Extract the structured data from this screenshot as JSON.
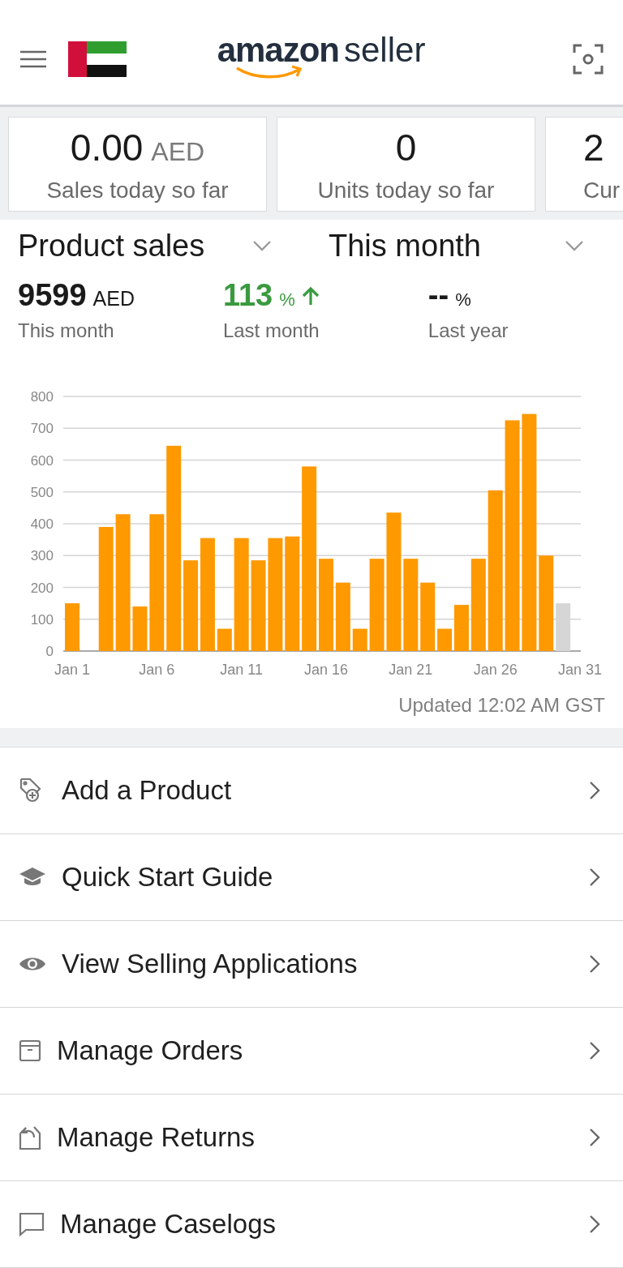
{
  "header": {
    "logo_word": "amazon",
    "logo_suffix": "seller"
  },
  "stat_cards": [
    {
      "value": "0.00",
      "unit": "AED",
      "label": "Sales today so far",
      "kind": "full"
    },
    {
      "value": "0",
      "label": "Units today so far",
      "kind": "full"
    },
    {
      "value": "2",
      "label": "Cur",
      "kind": "partial"
    }
  ],
  "selectors": [
    {
      "label": "Product sales"
    },
    {
      "label": "This month"
    }
  ],
  "metrics": [
    {
      "value": "9599",
      "unit": "AED",
      "label": "This month",
      "kind": "plain"
    },
    {
      "value": "113",
      "unit": "%",
      "label": "Last month",
      "kind": "rising"
    },
    {
      "value": "--",
      "unit": "%",
      "label": "Last year",
      "kind": "plain"
    }
  ],
  "chart": {
    "chart_data": {
      "type": "bar",
      "stacked": true,
      "grid": true,
      "categories": [
        "Jan 1",
        null,
        null,
        null,
        null,
        "Jan 6",
        null,
        null,
        null,
        null,
        "Jan 11",
        null,
        null,
        null,
        null,
        "Jan 16",
        null,
        null,
        null,
        null,
        "Jan 21",
        null,
        null,
        null,
        null,
        "Jan 26",
        null,
        null,
        null,
        null,
        "Jan 31"
      ],
      "yticks": [
        0,
        100,
        200,
        300,
        400,
        500,
        600,
        700,
        800
      ],
      "ylim": [
        0,
        800
      ],
      "series": [
        {
          "color": "#ff9900",
          "values": [
            150,
            0,
            390,
            430,
            140,
            430,
            645,
            285,
            355,
            70,
            355,
            285,
            355,
            360,
            580,
            290,
            215,
            70,
            290,
            435,
            290,
            215,
            70,
            145,
            290,
            505,
            725,
            745,
            300,
            null,
            null
          ]
        },
        {
          "color": "#d6d6d6",
          "values": [
            null,
            null,
            null,
            null,
            null,
            null,
            null,
            null,
            null,
            null,
            null,
            null,
            null,
            null,
            null,
            null,
            null,
            null,
            null,
            null,
            null,
            null,
            null,
            null,
            null,
            null,
            null,
            null,
            null,
            150,
            null
          ]
        }
      ]
    },
    "updated": "Updated 12:02 AM GST"
  },
  "menu": [
    {
      "kind": "tag",
      "label": "Add a Product"
    },
    {
      "kind": "cap",
      "label": "Quick Start Guide"
    },
    {
      "kind": "eye",
      "label": "View Selling Applications"
    },
    {
      "kind": "box",
      "label": "Manage Orders"
    },
    {
      "kind": "return",
      "label": "Manage Returns"
    },
    {
      "kind": "chat",
      "label": "Manage Caselogs"
    }
  ]
}
